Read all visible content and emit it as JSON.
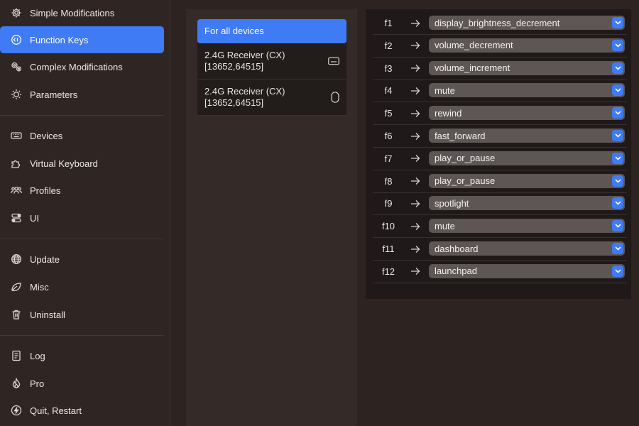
{
  "sidebar": {
    "items": [
      {
        "label": "Simple Modifications",
        "icon": "gear-icon"
      },
      {
        "label": "Function Keys",
        "icon": "function-keys-icon",
        "selected": true
      },
      {
        "label": "Complex Modifications",
        "icon": "gears-icon"
      },
      {
        "label": "Parameters",
        "icon": "sun-icon"
      },
      {
        "label": "Devices",
        "icon": "keyboard-icon"
      },
      {
        "label": "Virtual Keyboard",
        "icon": "puzzle-icon"
      },
      {
        "label": "Profiles",
        "icon": "people-icon"
      },
      {
        "label": "UI",
        "icon": "toggles-icon"
      },
      {
        "label": "Update",
        "icon": "globe-icon"
      },
      {
        "label": "Misc",
        "icon": "leaf-icon"
      },
      {
        "label": "Uninstall",
        "icon": "trash-icon"
      },
      {
        "label": "Log",
        "icon": "document-icon"
      },
      {
        "label": "Pro",
        "icon": "flame-icon"
      },
      {
        "label": "Quit, Restart",
        "icon": "bolt-icon"
      }
    ]
  },
  "devices": {
    "items": [
      {
        "label": "For all devices",
        "selected": true
      },
      {
        "label_line1": "2.4G Receiver (CX)",
        "label_line2": "[13652,64515]",
        "icon": "keyboard-icon"
      },
      {
        "label_line1": "2.4G Receiver (CX)",
        "label_line2": "[13652,64515]",
        "icon": "mouse-icon"
      }
    ]
  },
  "function_keys": [
    {
      "key": "f1",
      "value": "display_brightness_decrement"
    },
    {
      "key": "f2",
      "value": "volume_decrement"
    },
    {
      "key": "f3",
      "value": "volume_increment"
    },
    {
      "key": "f4",
      "value": "mute"
    },
    {
      "key": "f5",
      "value": "rewind"
    },
    {
      "key": "f6",
      "value": "fast_forward"
    },
    {
      "key": "f7",
      "value": "play_or_pause"
    },
    {
      "key": "f8",
      "value": "play_or_pause"
    },
    {
      "key": "f9",
      "value": "spotlight"
    },
    {
      "key": "f10",
      "value": "mute"
    },
    {
      "key": "f11",
      "value": "dashboard"
    },
    {
      "key": "f12",
      "value": "launchpad"
    }
  ],
  "colors": {
    "accent": "#3f7bf4",
    "background": "#2d2321",
    "panel": "#1f1a19",
    "select": "#5d5654"
  }
}
